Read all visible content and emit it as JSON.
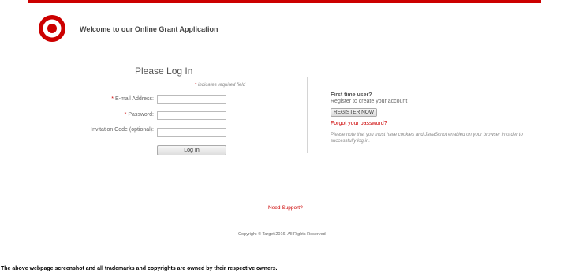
{
  "header": {
    "welcome": "Welcome to our Online Grant Application",
    "brand_color": "#cc0000"
  },
  "login": {
    "title": "Please Log In",
    "required_star": "*",
    "required_note": " indicates required field",
    "email_label": "E-mail Address:",
    "password_label": "Password:",
    "invitation_label": "Invitation Code (optional):",
    "email_value": "",
    "password_value": "",
    "invitation_value": "",
    "login_button": "Log In"
  },
  "register": {
    "title": "First time user?",
    "subtitle": "Register to create your account",
    "button": "REGISTER NOW",
    "forgot_link": "Forgot your password?",
    "cookie_note": "Please note that you must have cookies and JavaScript enabled on your browser in order to successfully log in."
  },
  "footer": {
    "support_link": "Need Support?",
    "copyright": "Copyright © Target 2016. All Rights Reserved"
  },
  "disclaimer": "The above webpage screenshot and all trademarks and copyrights are owned by their respective owners."
}
